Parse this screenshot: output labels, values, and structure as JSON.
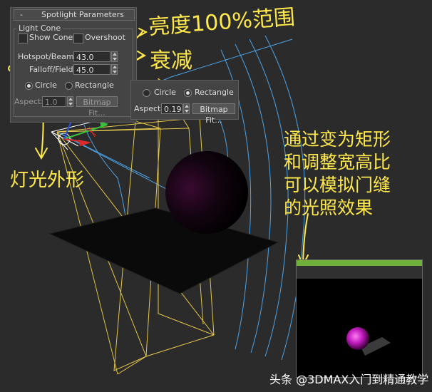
{
  "panel_main": {
    "minus": "-",
    "title": "Spotlight Parameters",
    "group_label": "Light Cone",
    "show_cone_label": "Show Cone",
    "overshoot_label": "Overshoot",
    "hotspot_label": "Hotspot/Beam:",
    "hotspot_value": "43.0",
    "falloff_label": "Falloff/Field:",
    "falloff_value": "45.0",
    "circle_label": "Circle",
    "rectangle_label": "Rectangle",
    "shape_selected": "Circle",
    "aspect_label": "Aspect:",
    "aspect_value": "1.0",
    "bitmap_fit_label": "Bitmap Fit..."
  },
  "panel_popup": {
    "circle_label": "Circle",
    "rectangle_label": "Rectangle",
    "shape_selected": "Rectangle",
    "aspect_label": "Aspect:",
    "aspect_value": "0.19",
    "bitmap_fit_label": "Bitmap Fit..."
  },
  "annotations": {
    "brightness_range": "亮度100%范围",
    "attenuation": "衰减",
    "light_shape": "灯光外形",
    "explanation_lines": [
      "通过变为矩形",
      "和调整宽高比",
      "可以模拟门缝",
      "的光照效果"
    ]
  },
  "watermark": "头条 @3DMAX入门到精通教学",
  "colors": {
    "annotation": "#ffe94a",
    "panel_bg": "#444444",
    "viewport_bg": "#2b2b2b",
    "wire_yellow": "#e6c84a",
    "wire_blue": "#4ea3e6",
    "render_magenta": "#d22fd0"
  }
}
